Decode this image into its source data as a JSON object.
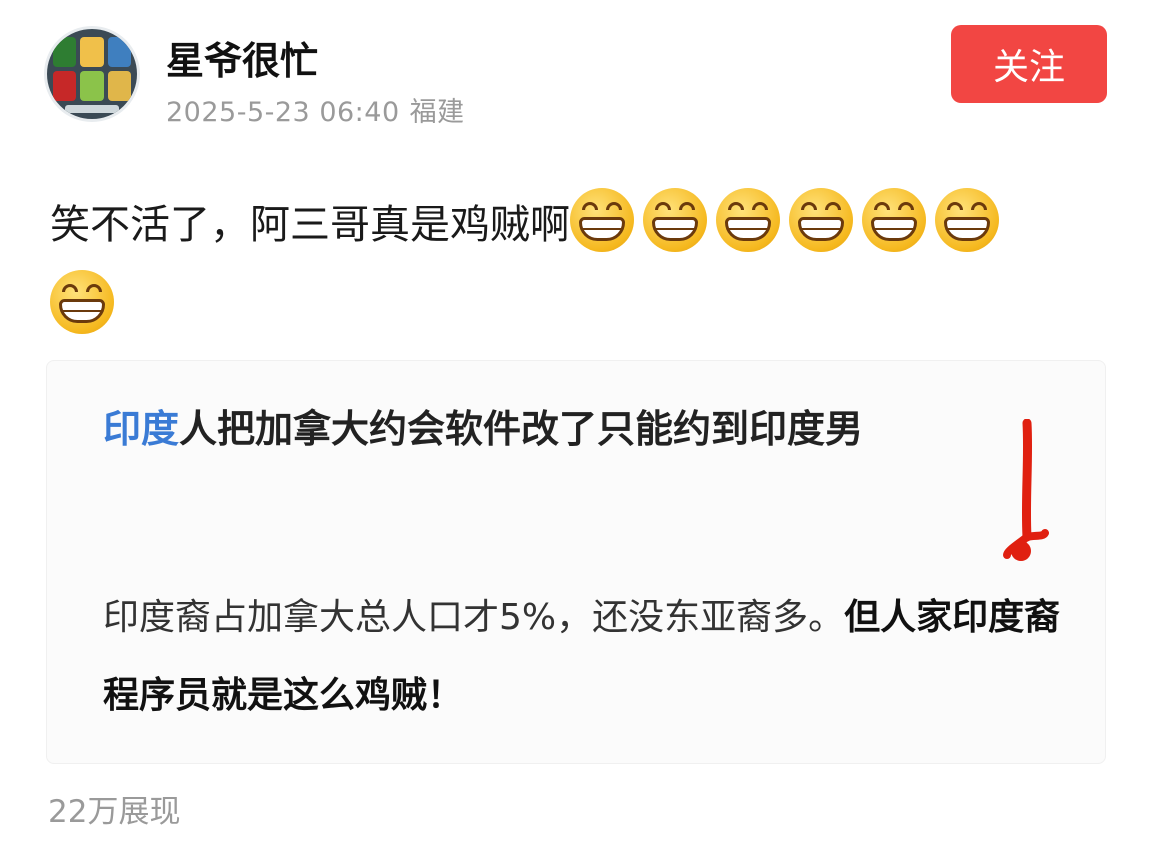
{
  "author": {
    "name": "星爷很忙",
    "date": "2025-5-23 06:40",
    "location": "福建"
  },
  "follow_label": "关注",
  "post": {
    "text": "笑不活了，阿三哥真是鸡贼啊",
    "emoji_count": 7,
    "emoji_name": "grin-emoji"
  },
  "card": {
    "title_highlight": "印度",
    "title_rest": "人把加拿大约会软件改了只能约到印度男",
    "body_normal": "印度裔占加拿大总人口才5%，还没东亚裔多。",
    "body_bold": "但人家印度裔程序员就是这么鸡贼！",
    "highlight_color": "#3a7bd5"
  },
  "views": "22万展现",
  "colors": {
    "follow_bg": "#f24643",
    "meta_gray": "#9a9a9a"
  }
}
